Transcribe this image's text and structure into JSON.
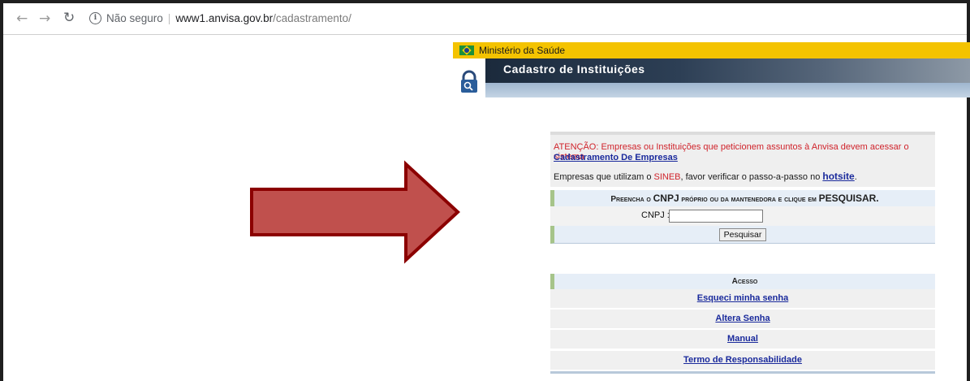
{
  "browser": {
    "back_icon": "back-arrow-icon",
    "forward_icon": "forward-arrow-icon",
    "reload_icon": "reload-icon",
    "security_label": "Não seguro",
    "url_host": "www1.anvisa.gov.br",
    "url_path": "/cadastramento/"
  },
  "header": {
    "ministry": "Ministério da Saúde",
    "system_title": "Cadastro de Instituições",
    "colors": {
      "ministry_bar": "#f4c300",
      "title_bar": "#1b2a3c"
    }
  },
  "notice": {
    "warning": "ATENÇÃO: Empresas ou Instituições que peticionem assuntos à Anvisa devem acessar o sistema",
    "link": "Cadastramento De Empresas",
    "sineb_prefix": "Empresas que utilizam o ",
    "sineb": "SINEB",
    "sineb_suffix": ", favor verificar o passo-a-passo no ",
    "hotsite": "hotsite",
    "period": "."
  },
  "search": {
    "instruction": "Preencha o ",
    "instruction_cnpj": "CNPJ",
    "instruction_rest": " próprio ou da mantenedora e clique em ",
    "instruction_action": "PESQUISAR.",
    "cnpj_label": "CNPJ :",
    "cnpj_value": "",
    "button": "Pesquisar"
  },
  "access": {
    "title": "Acesso",
    "items": [
      {
        "label": "Esqueci minha senha"
      },
      {
        "label": "Altera Senha"
      },
      {
        "label": "Manual"
      },
      {
        "label": "Termo de Responsabilidade"
      }
    ]
  },
  "annotation": {
    "arrow_color": "#c0504d",
    "arrow_border": "#8b0000"
  }
}
